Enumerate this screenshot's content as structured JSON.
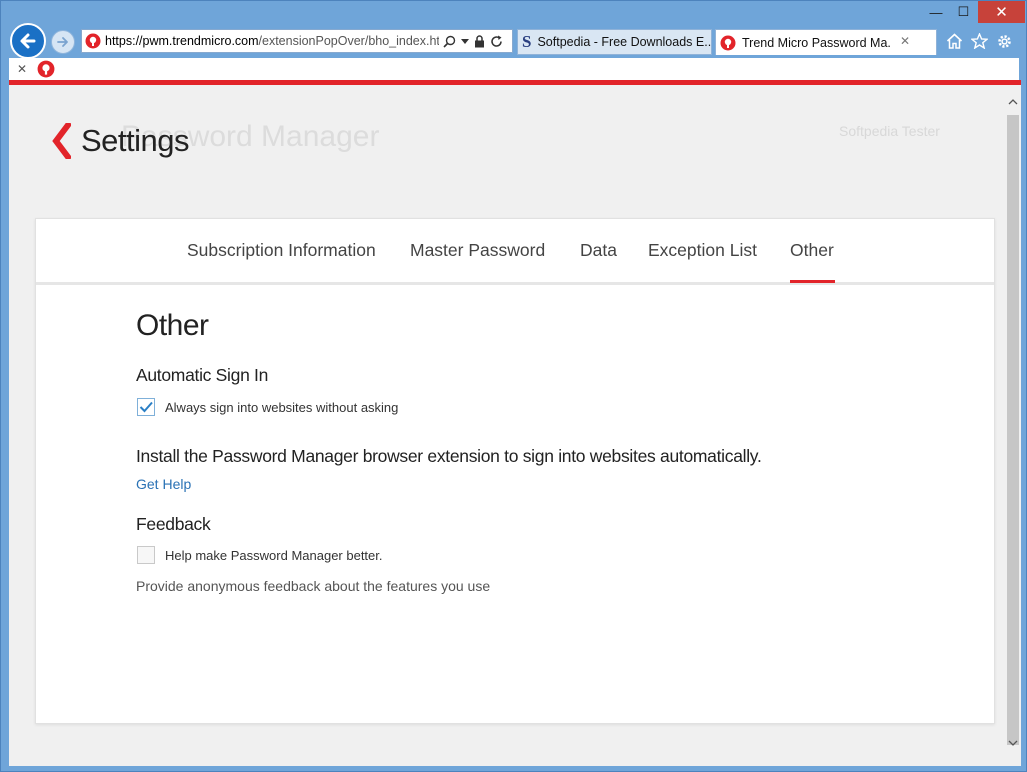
{
  "browser": {
    "window_controls": {
      "minimize": "—",
      "maximize": "☐",
      "close": "✕"
    },
    "address": {
      "scheme": "https://",
      "domain": "pwm.trendmicro.com",
      "path": "/extensionPopOver/bho_index.htm"
    },
    "tabs": [
      {
        "label": "Softpedia - Free Downloads E...",
        "active": false
      },
      {
        "label": "Trend Micro Password Ma...",
        "active": true,
        "close": "✕"
      }
    ],
    "toolbar_close": "✕"
  },
  "app": {
    "background_title": "Password Manager",
    "background_user": "Softpedia Tester",
    "page_title": "Settings",
    "accent_color": "#e2242a"
  },
  "settings_tabs": [
    {
      "label": "Subscription Information"
    },
    {
      "label": "Master Password"
    },
    {
      "label": "Data"
    },
    {
      "label": "Exception List"
    },
    {
      "label": "Other",
      "active": true
    }
  ],
  "other": {
    "heading": "Other",
    "auto_sign_in": {
      "heading": "Automatic Sign In",
      "checkbox_label": "Always sign into websites without asking",
      "checked": true
    },
    "install_text": "Install the Password Manager browser extension to sign into websites automatically.",
    "get_help": "Get Help",
    "feedback": {
      "heading": "Feedback",
      "checkbox_label": "Help make Password Manager better.",
      "checked": false,
      "description": "Provide anonymous feedback about the features you use"
    }
  }
}
